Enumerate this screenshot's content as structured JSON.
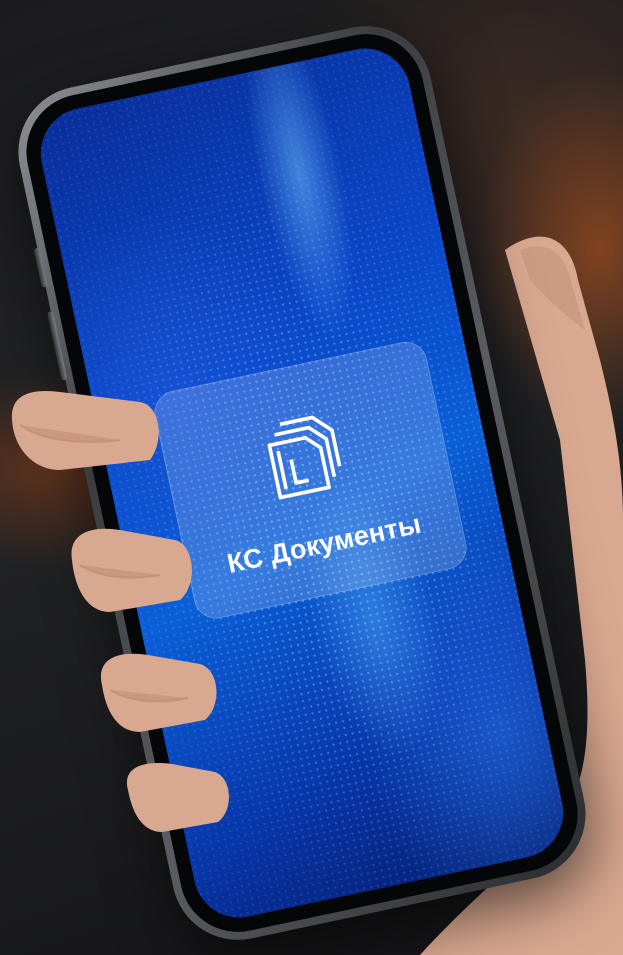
{
  "app": {
    "name": "КС Документы",
    "logo_icon": "stacked-documents-icon"
  },
  "colors": {
    "screen_blue": "#0a47c9",
    "frame": "#5a5d62",
    "text": "#ffffff"
  }
}
